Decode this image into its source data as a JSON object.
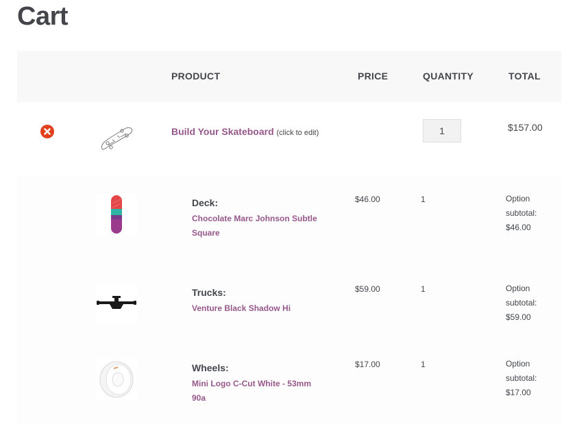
{
  "page": {
    "title": "Cart"
  },
  "table": {
    "headers": {
      "product": "PRODUCT",
      "price": "PRICE",
      "quantity": "QUANTITY",
      "total": "TOTAL"
    }
  },
  "main_item": {
    "name": "Build Your Skateboard",
    "note": "(click to edit)",
    "quantity": "1",
    "total": "$157.00"
  },
  "options": [
    {
      "label": "Deck:",
      "value": "Chocolate Marc Johnson Subtle Square",
      "price": "$46.00",
      "quantity": "1",
      "subtotal_label": "Option subtotal:",
      "subtotal": "$46.00"
    },
    {
      "label": "Trucks:",
      "value": "Venture Black Shadow Hi",
      "price": "$59.00",
      "quantity": "1",
      "subtotal_label": "Option subtotal:",
      "subtotal": "$59.00"
    },
    {
      "label": "Wheels:",
      "value": "Mini Logo C-Cut White - 53mm 90a",
      "price": "$17.00",
      "quantity": "1",
      "subtotal_label": "Option subtotal:",
      "subtotal": "$17.00"
    }
  ],
  "colors": {
    "link": "#96588a",
    "remove": "#e2401c",
    "text": "#43454b",
    "header_bg": "#f8f8f8"
  },
  "icons": {
    "remove": "remove-circle-x-icon"
  }
}
